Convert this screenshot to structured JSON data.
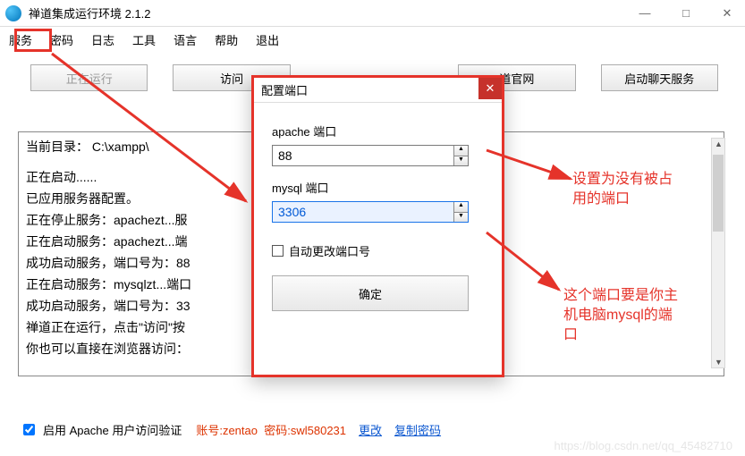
{
  "window": {
    "title": "禅道集成运行环境 2.1.2",
    "minimize": "—",
    "maximize": "□",
    "close": "✕"
  },
  "menu": [
    "服务",
    "密码",
    "日志",
    "工具",
    "语言",
    "帮助",
    "退出"
  ],
  "toolbar": {
    "running": "正在运行",
    "visit": "访问",
    "official": "道官网",
    "chat": "启动聊天服务"
  },
  "log": {
    "cwd_label": "当前目录：",
    "cwd_value": "C:\\xampp\\",
    "lines": [
      "正在启动......",
      "已应用服务器配置。",
      "正在停止服务：apachezt...服",
      "正在启动服务：apachezt...端",
      "成功启动服务，端口号为：88",
      "正在启动服务：mysqlzt...端口",
      "成功启动服务，端口号为：33",
      "禅道正在运行，点击\"访问\"按",
      "你也可以直接在浏览器访问："
    ]
  },
  "footer": {
    "enable_apache_auth": "启用 Apache 用户访问验证",
    "account_label": "账号:",
    "account_value": "zentao",
    "pwd_label": "密码:",
    "pwd_value": "swl580231",
    "change": "更改",
    "copy": "复制密码"
  },
  "dialog": {
    "title": "配置端口",
    "apache_label": "apache 端口",
    "apache_value": "88",
    "mysql_label": "mysql 端口",
    "mysql_value": "3306",
    "auto_change": "自动更改端口号",
    "ok": "确定"
  },
  "annotations": {
    "a1_l1": "设置为没有被占",
    "a1_l2": "用的端口",
    "a2_l1": "这个端口要是你主",
    "a2_l2": "机电脑mysql的端",
    "a2_l3": "口"
  },
  "watermark": "https://blog.csdn.net/qq_45482710"
}
